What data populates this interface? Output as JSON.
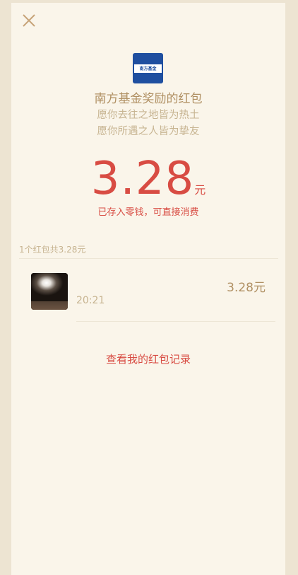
{
  "header": {
    "close_icon": "close-icon"
  },
  "sender": {
    "logo_text": "南方基金",
    "name": "南方基金奖励的红包",
    "wish_line1": "愿你去往之地皆为热土",
    "wish_line2": "愿你所遇之人皆为挚友"
  },
  "amount": {
    "value": "3.28",
    "unit": "元",
    "note": "已存入零钱，可直接消费"
  },
  "summary": {
    "text": "1个红包共3.28元"
  },
  "records": [
    {
      "amount": "3.28元",
      "time": "20:21"
    }
  ],
  "footer": {
    "view_records": "查看我的红包记录"
  },
  "colors": {
    "accent_red": "#d84c43",
    "gold_text": "#b09063",
    "muted_text": "#c7b491",
    "page_bg": "#faf5ea"
  }
}
